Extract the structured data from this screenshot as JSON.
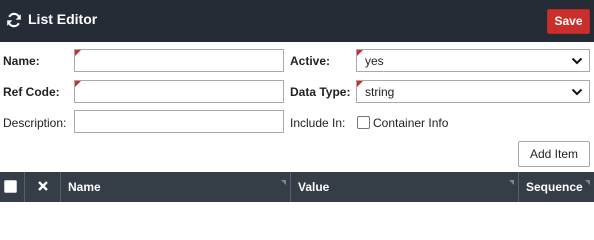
{
  "header": {
    "title": "List Editor",
    "save_label": "Save"
  },
  "form": {
    "name": {
      "label": "Name:",
      "value": ""
    },
    "ref_code": {
      "label": "Ref Code:",
      "value": ""
    },
    "description": {
      "label": "Description:",
      "value": ""
    },
    "active": {
      "label": "Active:",
      "value": "yes"
    },
    "data_type": {
      "label": "Data Type:",
      "value": "string"
    },
    "include_in": {
      "label": "Include In:",
      "option_label": "Container Info"
    },
    "add_item_label": "Add Item"
  },
  "table": {
    "columns": [
      "Name",
      "Value",
      "Sequence"
    ]
  },
  "colors": {
    "header_bg": "#252c36",
    "save_bg": "#c9302c",
    "table_header_bg": "#353d47",
    "required_marker": "#c9302c"
  }
}
